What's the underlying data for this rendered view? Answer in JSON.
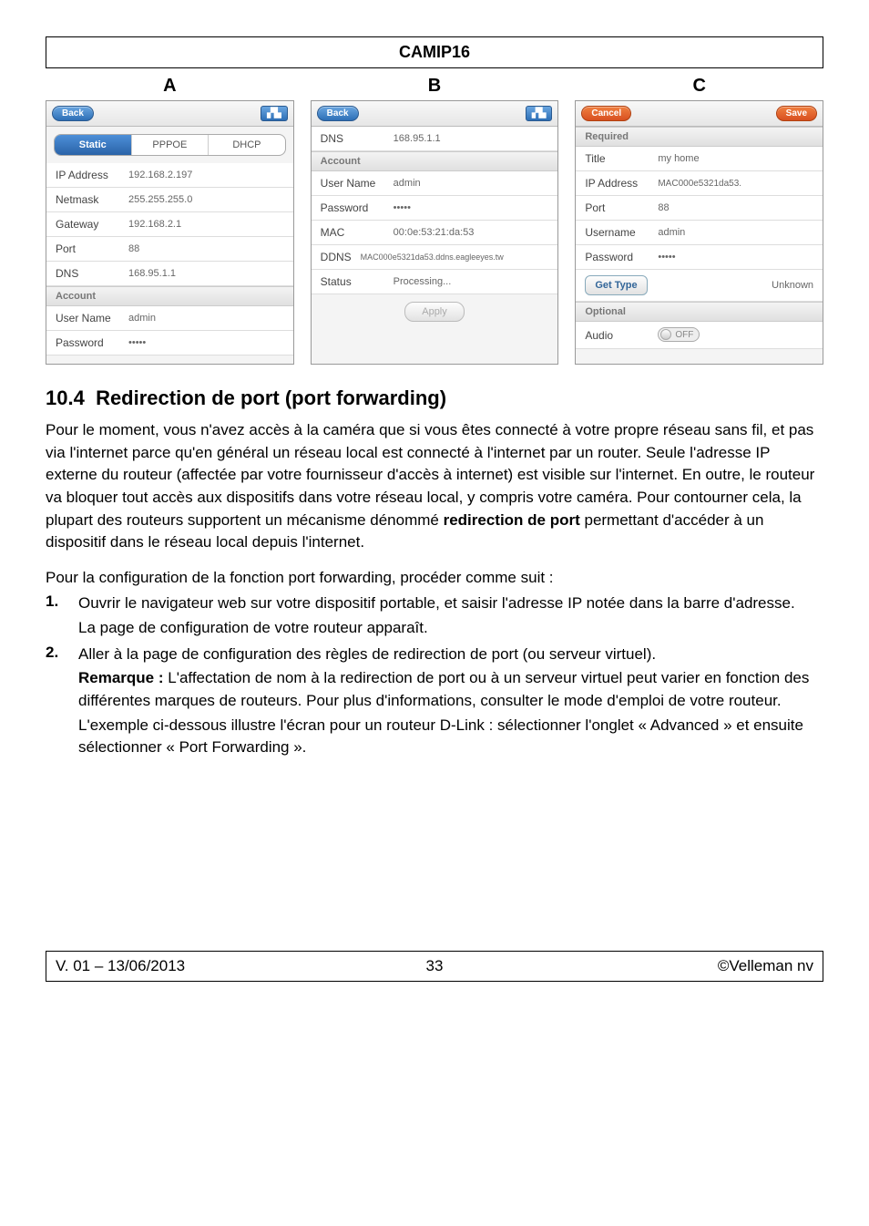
{
  "header": {
    "title": "CAMIP16"
  },
  "panels": {
    "A": {
      "letter": "A",
      "back": "Back",
      "segments": [
        "Static",
        "PPPOE",
        "DHCP"
      ],
      "active_segment": "Static",
      "rows": [
        {
          "k": "IP Address",
          "v": "192.168.2.197"
        },
        {
          "k": "Netmask",
          "v": "255.255.255.0"
        },
        {
          "k": "Gateway",
          "v": "192.168.2.1"
        },
        {
          "k": "Port",
          "v": "88"
        },
        {
          "k": "DNS",
          "v": "168.95.1.1"
        }
      ],
      "account_header": "Account",
      "account": [
        {
          "k": "User Name",
          "v": "admin"
        },
        {
          "k": "Password",
          "v": "•••••"
        }
      ]
    },
    "B": {
      "letter": "B",
      "back": "Back",
      "rows_top": [
        {
          "k": "DNS",
          "v": "168.95.1.1"
        }
      ],
      "account_header": "Account",
      "account": [
        {
          "k": "User Name",
          "v": "admin"
        },
        {
          "k": "Password",
          "v": "•••••"
        }
      ],
      "rows_mid": [
        {
          "k": "MAC",
          "v": "00:0e:53:21:da:53"
        },
        {
          "k": "DDNS",
          "v": "MAC000e5321da53.ddns.eagleeyes.tw"
        },
        {
          "k": "Status",
          "v": "Processing..."
        }
      ],
      "apply": "Apply"
    },
    "C": {
      "letter": "C",
      "cancel": "Cancel",
      "save": "Save",
      "required_header": "Required",
      "required": [
        {
          "k": "Title",
          "v": "my home"
        },
        {
          "k": "IP Address",
          "v": "MAC000e5321da53."
        },
        {
          "k": "Port",
          "v": "88"
        },
        {
          "k": "Username",
          "v": "admin"
        },
        {
          "k": "Password",
          "v": "•••••"
        }
      ],
      "get_type": "Get Type",
      "get_type_value": "Unknown",
      "optional_header": "Optional",
      "audio_label": "Audio",
      "audio_value": "OFF"
    }
  },
  "section": {
    "number": "10.4",
    "title": "Redirection de port (port forwarding)",
    "para1_a": "Pour le moment, vous n'avez accès à la caméra que si vous êtes connecté à votre propre réseau sans fil, et pas via l'internet parce qu'en général un réseau local est connecté à l'internet par un router. Seule l'adresse IP externe du routeur (affectée par votre fournisseur d'accès à internet) est visible sur l'internet. En outre, le routeur va bloquer tout accès aux dispositifs dans votre réseau local, y compris votre caméra. Pour contourner cela, la plupart des routeurs supportent un mécanisme dénommé ",
    "para1_bold": "redirection de port",
    "para1_b": " permettant d'accéder à un dispositif dans le réseau local depuis l'internet.",
    "para2": "Pour la configuration de la fonction port forwarding, procéder comme suit :",
    "steps": [
      {
        "num": "1.",
        "main": "Ouvrir le navigateur web sur votre dispositif portable, et saisir l'adresse IP notée dans la barre d'adresse.",
        "sub1": "La page de configuration de votre routeur apparaît."
      },
      {
        "num": "2.",
        "main": "Aller à la page de configuration des règles de redirection de port (ou serveur virtuel).",
        "remark_label": "Remarque :",
        "remark_text": " L'affectation de nom à la redirection de port ou à un serveur virtuel peut varier en fonction des différentes marques de routeurs. Pour plus d'informations, consulter le mode d'emploi de votre routeur.",
        "example": "L'exemple ci-dessous illustre l'écran pour un routeur D-Link : sélectionner l'onglet « Advanced » et ensuite sélectionner « Port Forwarding »."
      }
    ]
  },
  "footer": {
    "left": "V. 01 – 13/06/2013",
    "center": "33",
    "right": "©Velleman nv"
  }
}
